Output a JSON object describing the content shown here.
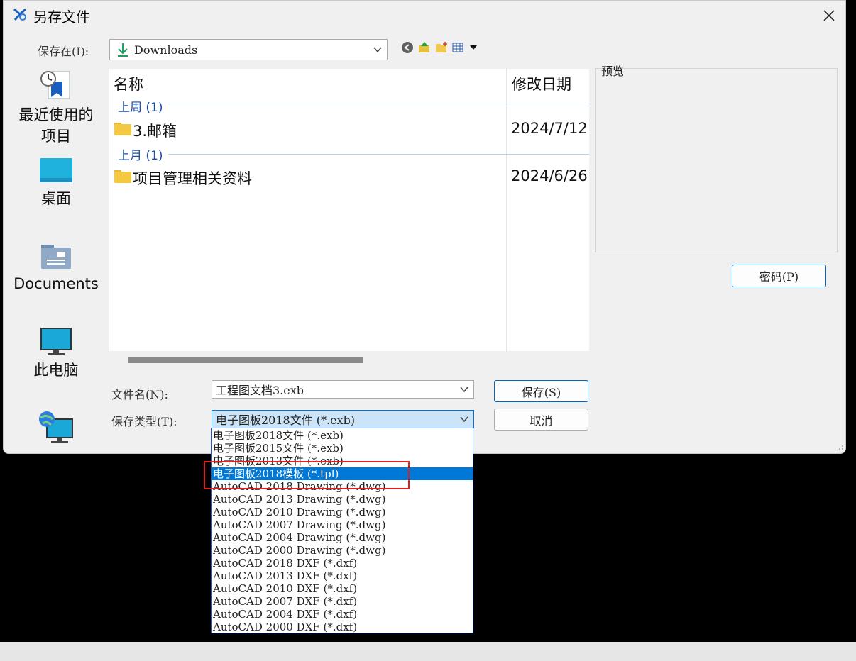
{
  "dialog": {
    "title": "另存文件",
    "save_in_label": "保存在(I):",
    "save_in_value": "Downloads",
    "preview_label": "预览",
    "password_button": "密码(P)",
    "filename_label": "文件名(N):",
    "filename_value": "工程图文档3.exb",
    "filetype_label": "保存类型(T):",
    "filetype_value": "电子图板2018文件 (*.exb)",
    "save_button": "保存(S)",
    "cancel_button": "取消"
  },
  "places": [
    {
      "label": "最近使用的项目",
      "icon": "recent-items-icon"
    },
    {
      "label": "桌面",
      "icon": "desktop-icon"
    },
    {
      "label": "Documents",
      "icon": "documents-icon"
    },
    {
      "label": "此电脑",
      "icon": "this-pc-icon"
    },
    {
      "label": "",
      "icon": "network-icon"
    }
  ],
  "file_list": {
    "columns": [
      "名称",
      "修改日期"
    ],
    "groups": [
      {
        "header": "上周 (1)",
        "items": [
          {
            "name": "3.邮箱",
            "date": "2024/7/12"
          }
        ]
      },
      {
        "header": "上月 (1)",
        "items": [
          {
            "name": "项目管理相关资料",
            "date": "2024/6/26"
          }
        ]
      }
    ]
  },
  "filetype_options": [
    "电子图板2018文件 (*.exb)",
    "电子图板2015文件 (*.exb)",
    "电子图板2013文件 (*.exb)",
    "电子图板2018模板 (*.tpl)",
    "AutoCAD 2018 Drawing (*.dwg)",
    "AutoCAD 2013 Drawing (*.dwg)",
    "AutoCAD 2010 Drawing (*.dwg)",
    "AutoCAD 2007 Drawing (*.dwg)",
    "AutoCAD 2004 Drawing (*.dwg)",
    "AutoCAD 2000 Drawing (*.dwg)",
    "AutoCAD 2018 DXF (*.dxf)",
    "AutoCAD 2013 DXF (*.dxf)",
    "AutoCAD 2010 DXF (*.dxf)",
    "AutoCAD 2007 DXF (*.dxf)",
    "AutoCAD 2004 DXF (*.dxf)",
    "AutoCAD 2000 DXF (*.dxf)"
  ],
  "selected_option_index": 3,
  "colors": {
    "accent": "#0078d7",
    "highlight_box": "#e02020",
    "group_header": "#1c4fa3"
  }
}
